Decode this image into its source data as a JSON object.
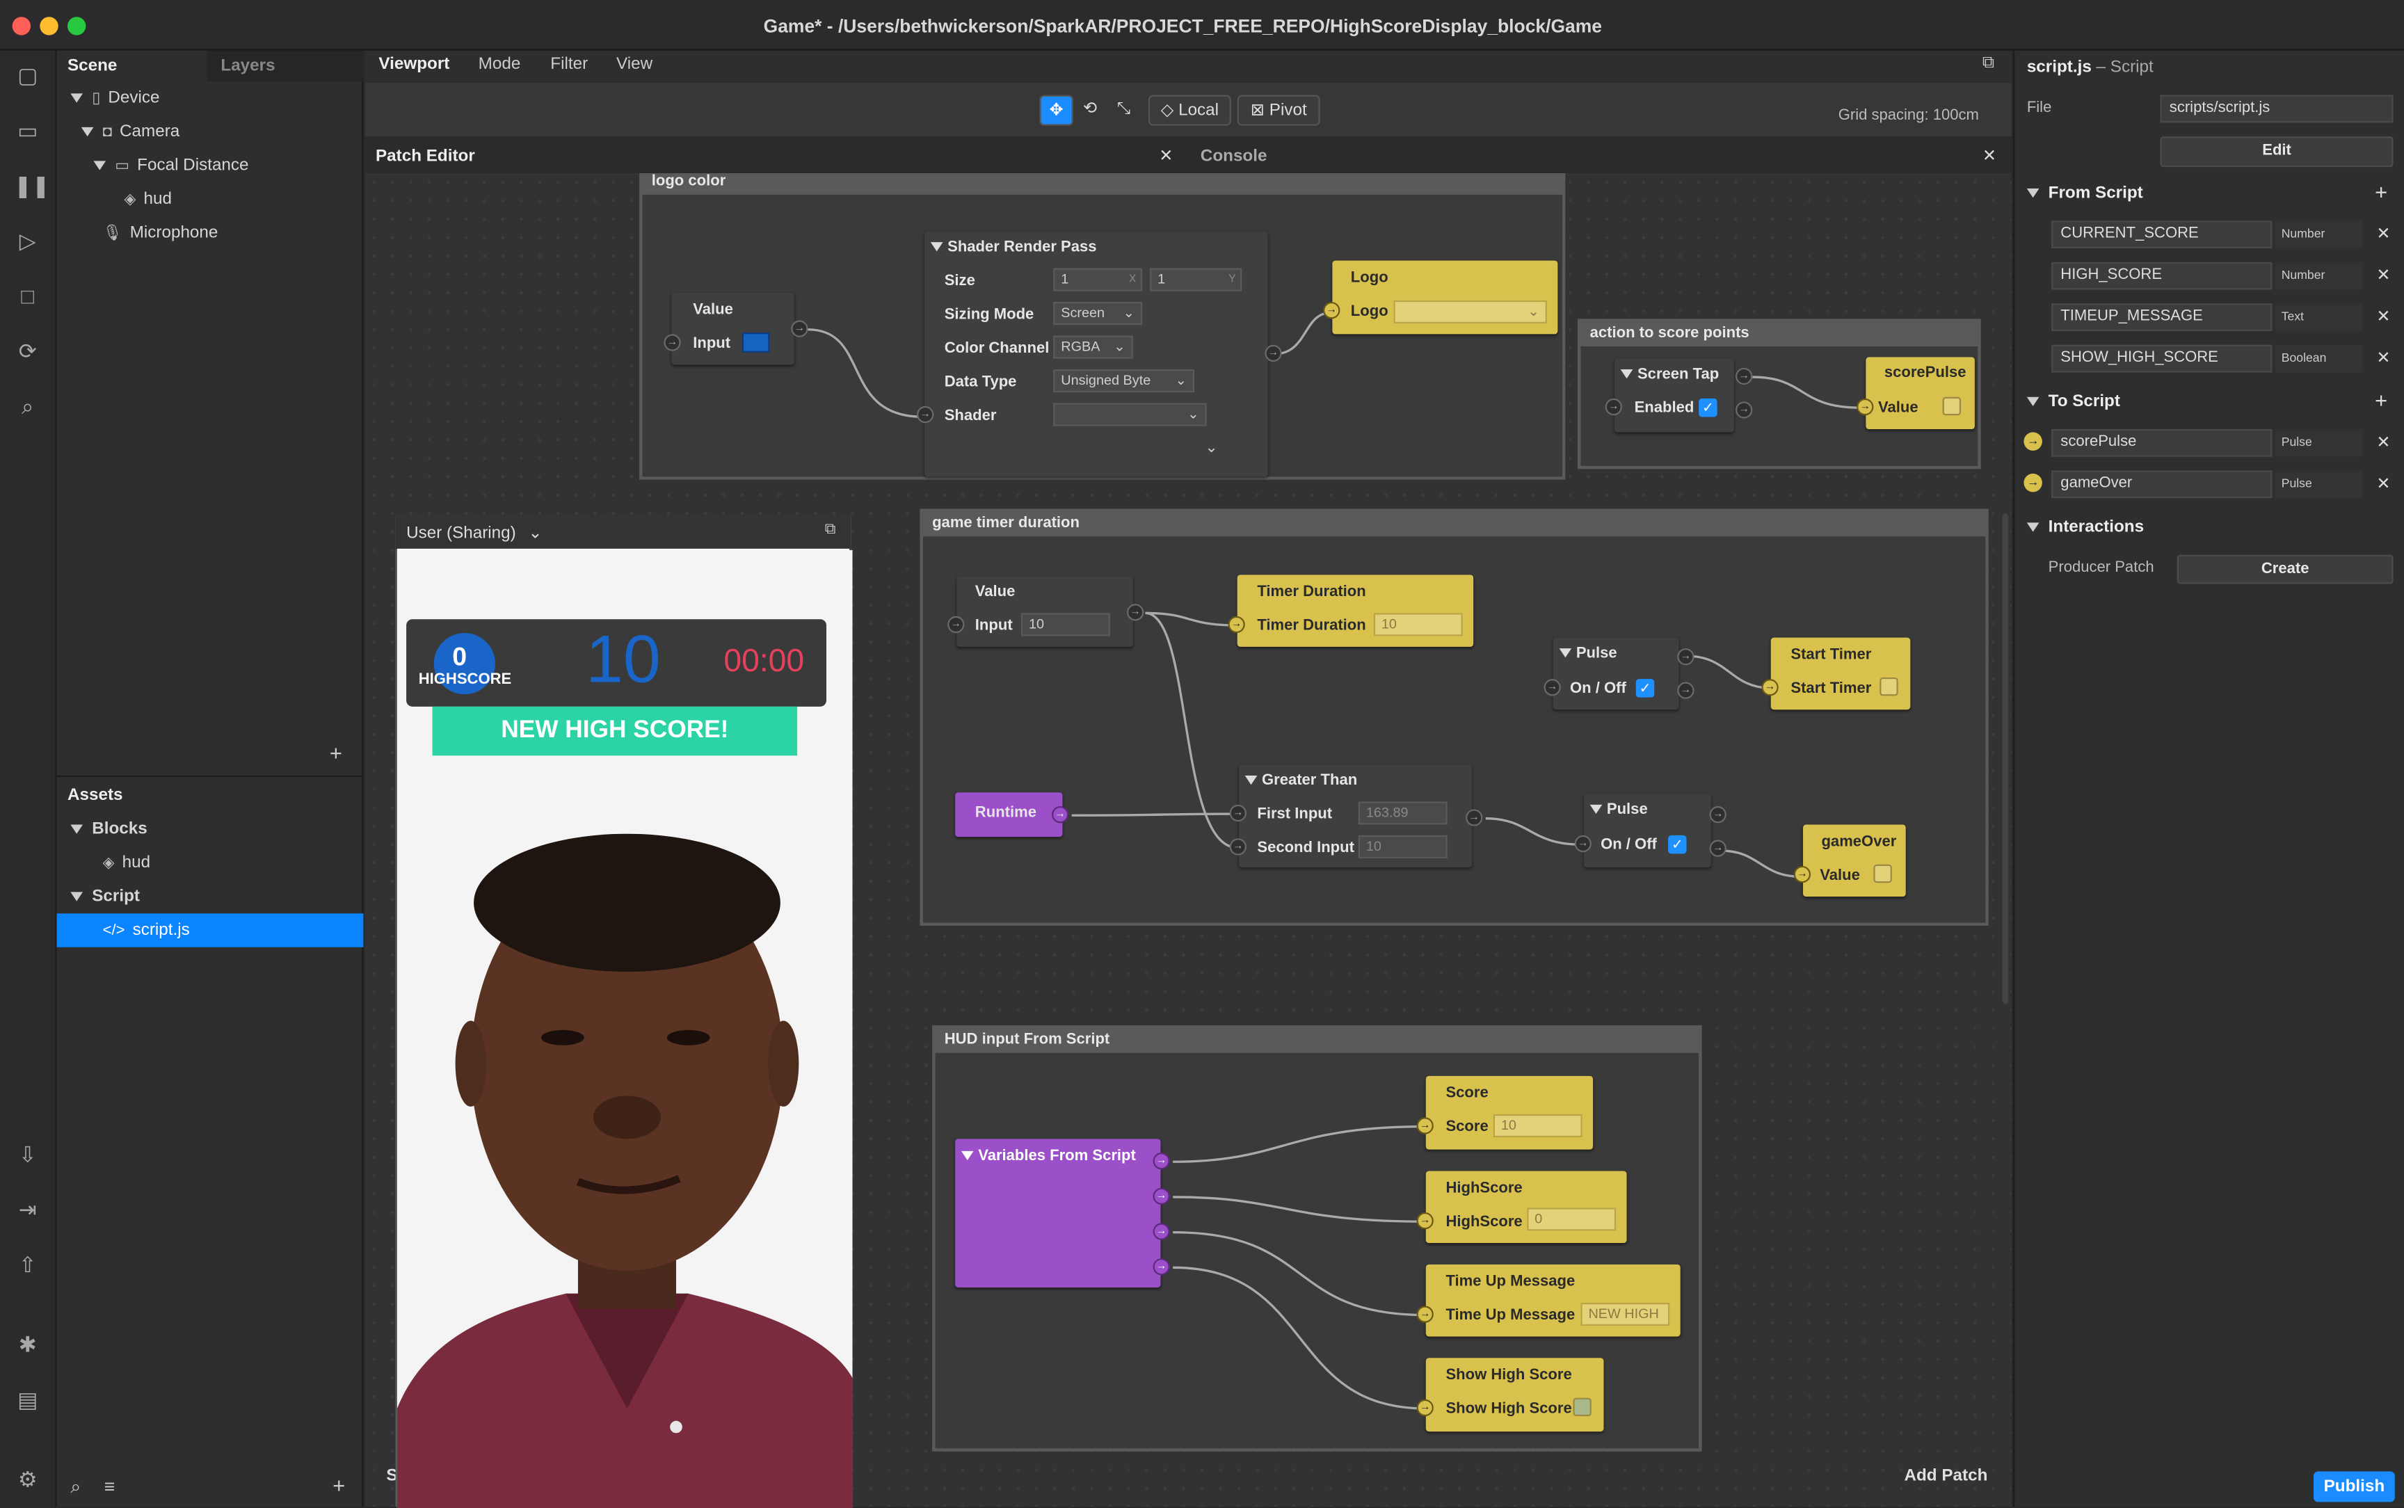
{
  "window": {
    "title": "Game* - /Users/bethwickerson/SparkAR/PROJECT_FREE_REPO/HighScoreDisplay_block/Game"
  },
  "scene": {
    "tab_scene": "Scene",
    "tab_layers": "Layers",
    "device": "Device",
    "camera": "Camera",
    "focal_distance": "Focal Distance",
    "hud": "hud",
    "microphone": "Microphone"
  },
  "assets": {
    "title": "Assets",
    "blocks": "Blocks",
    "hud": "hud",
    "script": "Script",
    "script_file": "script.js"
  },
  "viewport": {
    "tab": "Viewport",
    "mode": "Mode",
    "filter": "Filter",
    "view": "View",
    "local": "Local",
    "pivot": "Pivot",
    "grid": "Grid spacing: 100cm"
  },
  "patch": {
    "title": "Patch Editor",
    "console": "Console",
    "add_patch": "Add Patch"
  },
  "groups": {
    "logo": "logo color",
    "score": "action to score points",
    "timer": "game timer duration",
    "hud": "HUD input From Script"
  },
  "nodes": {
    "value1": {
      "title": "Value",
      "input": "Input"
    },
    "shader": {
      "title": "Shader Render Pass",
      "size": "Size",
      "size_x": "1",
      "size_y": "1",
      "x": "X",
      "y": "Y",
      "sizing_mode": "Sizing Mode",
      "sizing_val": "Screen",
      "color_channel": "Color Channel",
      "color_val": "RGBA",
      "data_type": "Data Type",
      "data_val": "Unsigned Byte",
      "shader": "Shader"
    },
    "logo": {
      "title": "Logo",
      "port": "Logo"
    },
    "screentap": {
      "title": "Screen Tap",
      "enabled": "Enabled"
    },
    "scorepulse": {
      "title": "scorePulse",
      "value": "Value"
    },
    "value2": {
      "title": "Value",
      "input": "Input",
      "val": "10"
    },
    "timerdur": {
      "title": "Timer Duration",
      "port": "Timer Duration",
      "val": "10"
    },
    "pulse1": {
      "title": "Pulse",
      "onoff": "On / Off"
    },
    "starttimer": {
      "title": "Start Timer",
      "port": "Start Timer"
    },
    "runtime": {
      "title": "Runtime"
    },
    "greater": {
      "title": "Greater Than",
      "first": "First Input",
      "first_val": "163.89",
      "second": "Second Input",
      "second_val": "10"
    },
    "pulse2": {
      "title": "Pulse",
      "onoff": "On / Off"
    },
    "gameover": {
      "title": "gameOver",
      "value": "Value"
    },
    "vars": {
      "title": "Variables From Script"
    },
    "score": {
      "title": "Score",
      "port": "Score",
      "val": "10"
    },
    "highscore": {
      "title": "HighScore",
      "port": "HighScore",
      "val": "0"
    },
    "timeup": {
      "title": "Time Up Message",
      "port": "Time Up Message",
      "val": "NEW HIGH"
    },
    "showhigh": {
      "title": "Show High Score",
      "port": "Show High Score"
    }
  },
  "preview": {
    "label": "User (Sharing)",
    "score": "0",
    "highscore": "HIGHSCORE",
    "points": "10",
    "timer": "00:00",
    "banner": "NEW HIGH SCORE!",
    "footer": "S"
  },
  "inspector": {
    "title": "script.js",
    "subtitle": "– Script",
    "file_label": "File",
    "file_val": "scripts/script.js",
    "edit": "Edit",
    "from_script": "From Script",
    "from_vars": [
      {
        "name": "CURRENT_SCORE",
        "type": "Number"
      },
      {
        "name": "HIGH_SCORE",
        "type": "Number"
      },
      {
        "name": "TIMEUP_MESSAGE",
        "type": "Text"
      },
      {
        "name": "SHOW_HIGH_SCORE",
        "type": "Boolean"
      }
    ],
    "to_script": "To Script",
    "to_vars": [
      {
        "name": "scorePulse",
        "type": "Pulse"
      },
      {
        "name": "gameOver",
        "type": "Pulse"
      }
    ],
    "interactions": "Interactions",
    "producer": "Producer Patch",
    "create": "Create",
    "publish": "Publish"
  },
  "colors": {
    "accent": "#1a8cff",
    "patch_yellow": "#d9c14e",
    "patch_purple": "#9b4fc8",
    "banner": "#2bd3a5",
    "score_blue": "#1a66c8",
    "timer_red": "#e5405e",
    "logo_swatch": "#1565c0"
  }
}
